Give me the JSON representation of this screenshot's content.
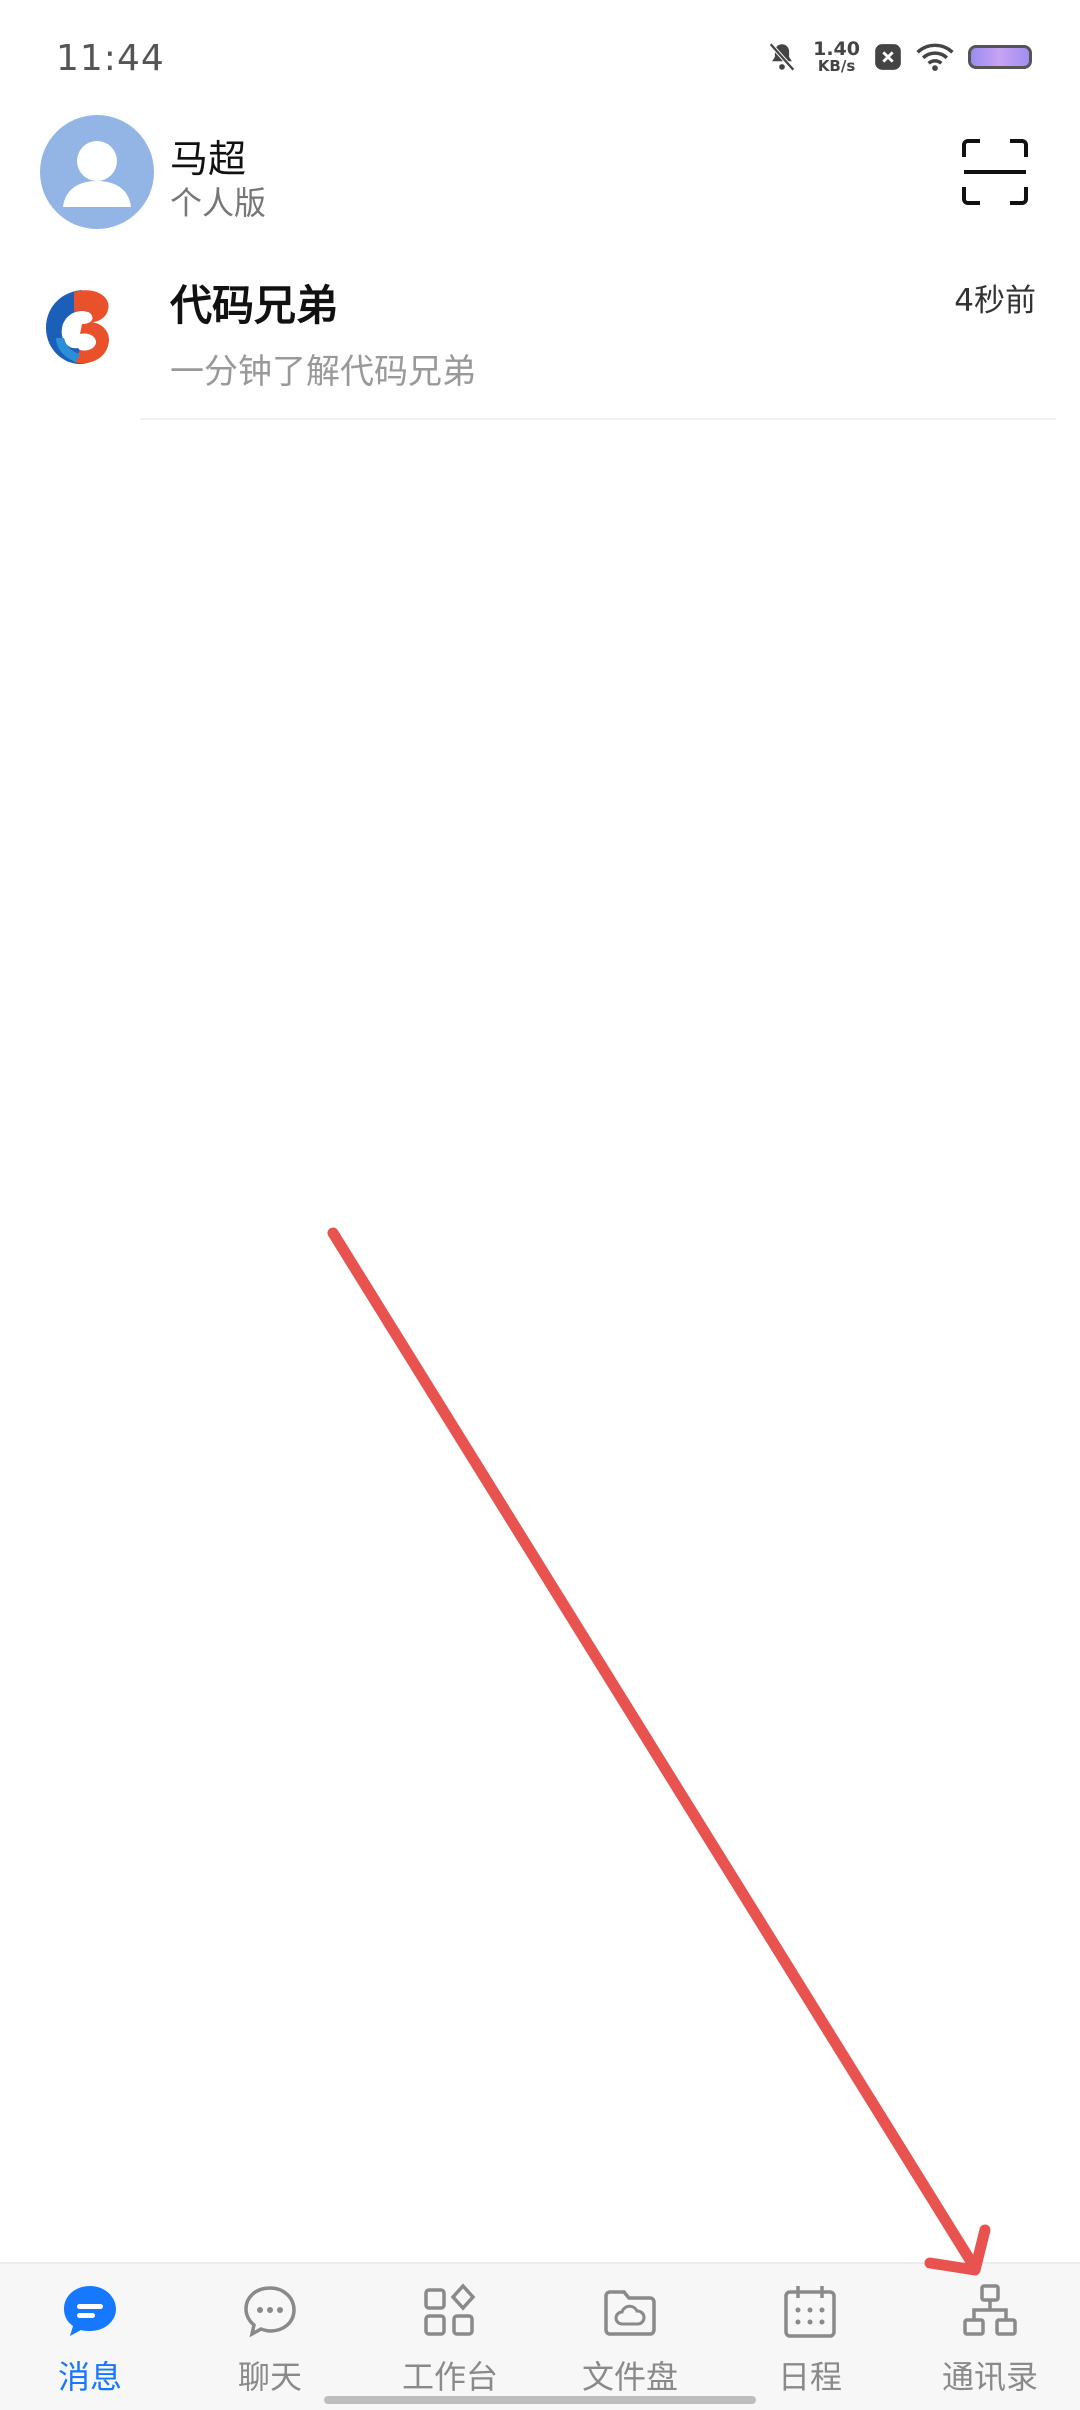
{
  "status_bar": {
    "time": "11:44",
    "net_speed_value": "1.40",
    "net_speed_unit": "KB/s",
    "icons": [
      "mute-bell-icon",
      "close-square-icon",
      "wifi-icon",
      "battery-icon"
    ]
  },
  "header": {
    "user_name": "马超",
    "plan": "个人版",
    "scan_icon": "scan-icon"
  },
  "chats": [
    {
      "title": "代码兄弟",
      "time": "4秒前",
      "preview": "一分钟了解代码兄弟"
    }
  ],
  "bottom_nav": {
    "items": [
      {
        "label": "消息",
        "icon": "message-icon",
        "active": true
      },
      {
        "label": "聊天",
        "icon": "chat-icon",
        "active": false
      },
      {
        "label": "工作台",
        "icon": "workbench-icon",
        "active": false
      },
      {
        "label": "文件盘",
        "icon": "cloud-disk-icon",
        "active": false
      },
      {
        "label": "日程",
        "icon": "calendar-icon",
        "active": false
      },
      {
        "label": "通讯录",
        "icon": "contacts-icon",
        "active": false
      }
    ]
  },
  "colors": {
    "accent": "#1677ff",
    "arrow": "#e8524f",
    "avatar_bg": "#92b5e6"
  }
}
